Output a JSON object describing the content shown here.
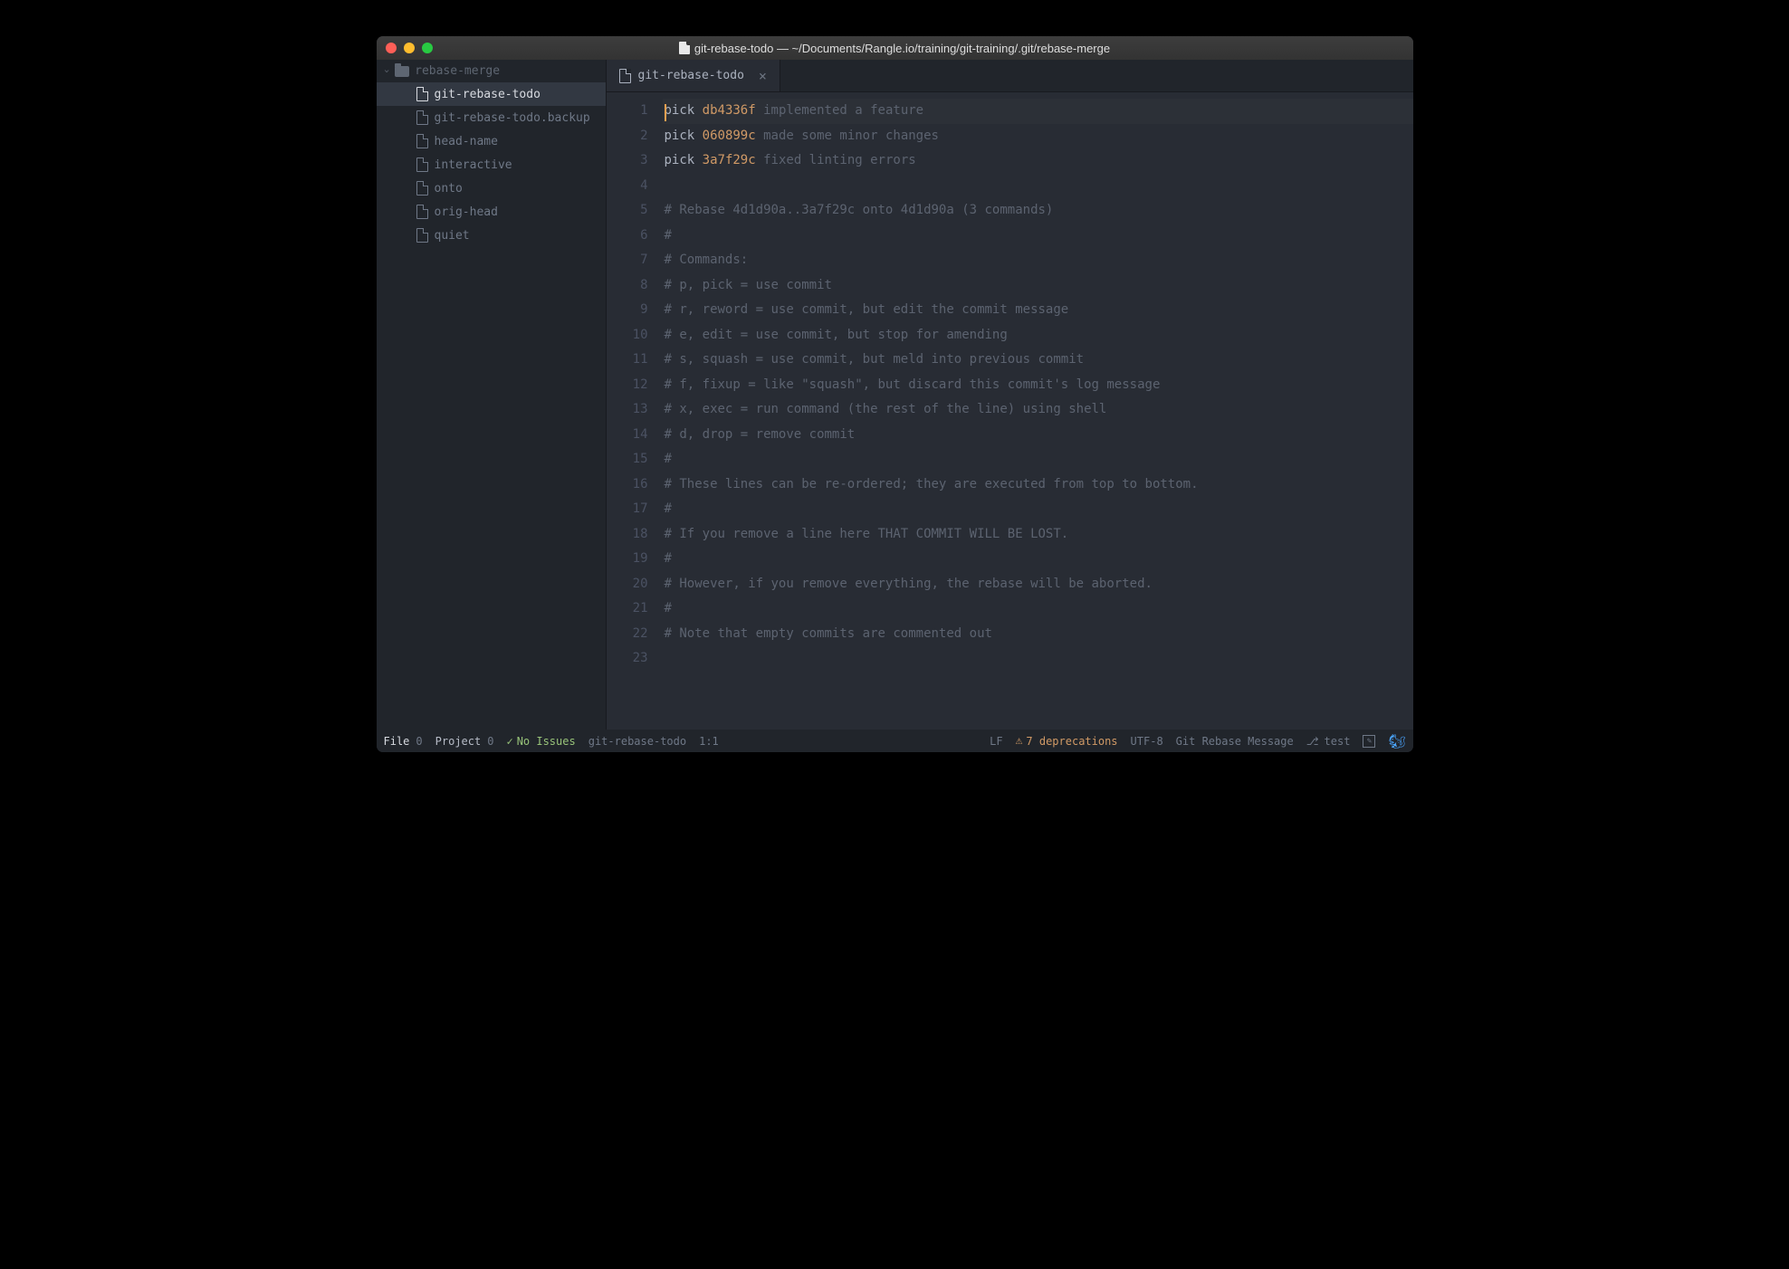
{
  "window": {
    "title": "git-rebase-todo — ~/Documents/Rangle.io/training/git-training/.git/rebase-merge"
  },
  "sidebar": {
    "root": "rebase-merge",
    "items": [
      {
        "label": "git-rebase-todo",
        "active": true
      },
      {
        "label": "git-rebase-todo.backup",
        "active": false
      },
      {
        "label": "head-name",
        "active": false
      },
      {
        "label": "interactive",
        "active": false
      },
      {
        "label": "onto",
        "active": false
      },
      {
        "label": "orig-head",
        "active": false
      },
      {
        "label": "quiet",
        "active": false
      }
    ]
  },
  "tabs": {
    "0": {
      "label": "git-rebase-todo"
    }
  },
  "code": {
    "lines": [
      {
        "cmd": "pick",
        "hash": "db4336f",
        "msg": "implemented a feature"
      },
      {
        "cmd": "pick",
        "hash": "060899c",
        "msg": "made some minor changes"
      },
      {
        "cmd": "pick",
        "hash": "3a7f29c",
        "msg": "fixed linting errors"
      }
    ],
    "comments": [
      "",
      "# Rebase 4d1d90a..3a7f29c onto 4d1d90a (3 commands)",
      "#",
      "# Commands:",
      "# p, pick = use commit",
      "# r, reword = use commit, but edit the commit message",
      "# e, edit = use commit, but stop for amending",
      "# s, squash = use commit, but meld into previous commit",
      "# f, fixup = like \"squash\", but discard this commit's log message",
      "# x, exec = run command (the rest of the line) using shell",
      "# d, drop = remove commit",
      "#",
      "# These lines can be re-ordered; they are executed from top to bottom.",
      "#",
      "# If you remove a line here THAT COMMIT WILL BE LOST.",
      "#",
      "# However, if you remove everything, the rebase will be aborted.",
      "#",
      "# Note that empty commits are commented out",
      ""
    ]
  },
  "status": {
    "file_label": "File",
    "file_count": "0",
    "project_label": "Project",
    "project_count": "0",
    "no_issues": "No Issues",
    "filename": "git-rebase-todo",
    "cursor": "1:1",
    "line_ending": "LF",
    "deprecations": "7 deprecations",
    "encoding": "UTF-8",
    "grammar": "Git Rebase Message",
    "branch": "test"
  }
}
